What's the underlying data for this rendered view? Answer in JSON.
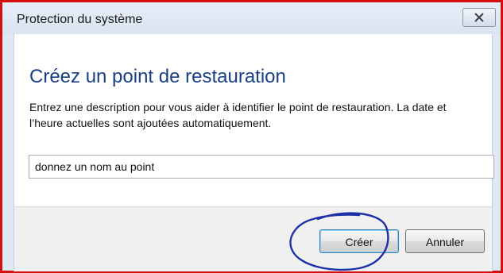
{
  "window": {
    "title": "Protection du système",
    "close_icon": "close-icon"
  },
  "dialog": {
    "heading": "Créez un point de restauration",
    "description": "Entrez une description pour vous aider à identifier le point de restauration. La date et l’heure actuelles sont ajoutées automatiquement.",
    "name_input_value": "donnez un nom au point"
  },
  "buttons": {
    "create_label": "Créer",
    "cancel_label": "Annuler"
  },
  "colors": {
    "frame_border": "#d40f0f",
    "heading": "#1b3f86",
    "annotation": "#1f2fa8"
  }
}
